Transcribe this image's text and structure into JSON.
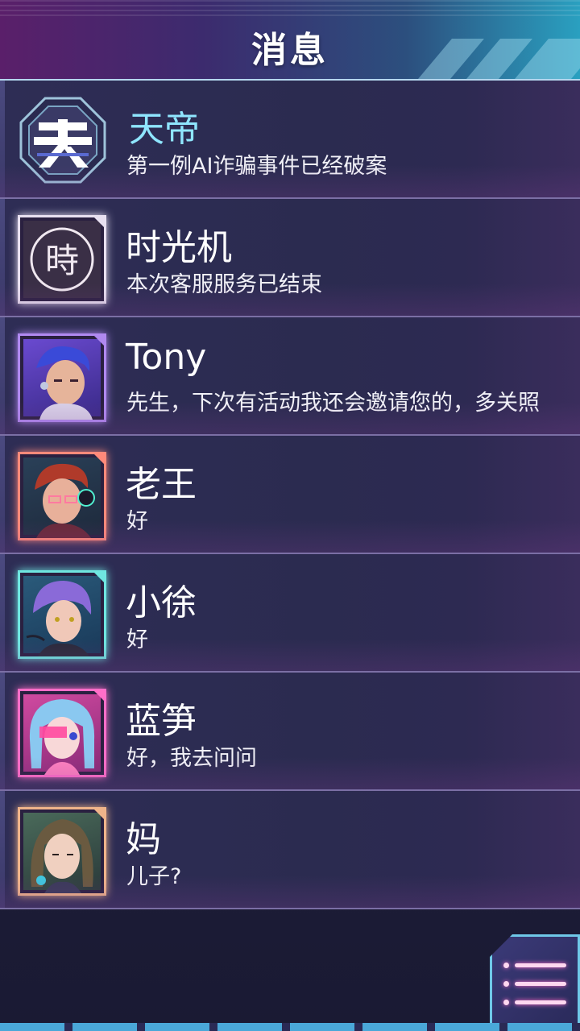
{
  "header": {
    "title": "消息"
  },
  "contacts": [
    {
      "name": "天帝",
      "message": "第一例AI诈骗事件已经破案",
      "frame_color": "#9ec3da",
      "icon": "tiandi-logo-icon"
    },
    {
      "name": "时光机",
      "message": "本次客服服务已结束",
      "frame_color": "#e8e0f0",
      "icon": "time-machine-logo-icon"
    },
    {
      "name": "Tony",
      "message": "先生，下次有活动我还会邀请您的，多关照",
      "frame_color": "#b089f0",
      "icon": "avatar-tony"
    },
    {
      "name": "老王",
      "message": "好",
      "frame_color": "#ff8a7a",
      "icon": "avatar-laowang"
    },
    {
      "name": "小徐",
      "message": "好",
      "frame_color": "#6fe6e0",
      "icon": "avatar-xiaoxu"
    },
    {
      "name": "蓝笋",
      "message": "好，我去问问",
      "frame_color": "#ff6ec8",
      "icon": "avatar-lansun"
    },
    {
      "name": "妈",
      "message": "儿子?",
      "frame_color": "#f0b48a",
      "icon": "avatar-mom"
    }
  ],
  "menu_button": {
    "icon": "menu-list-icon"
  }
}
